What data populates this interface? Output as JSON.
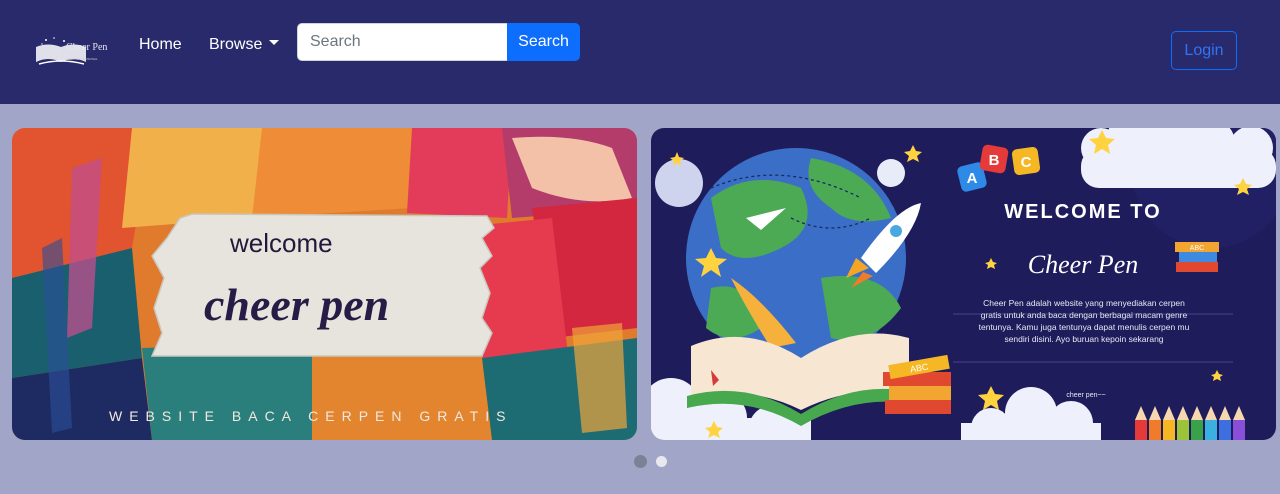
{
  "navbar": {
    "logo_text": "Cheer Pen",
    "logo_subtext": "CERPEN PERSONAL",
    "home_label": "Home",
    "browse_label": "Browse",
    "search_placeholder": "Search",
    "search_button": "Search",
    "login_button": "Login"
  },
  "carousel": {
    "slide1": {
      "line1": "welcome",
      "line2": "cheer pen",
      "tagline": "WEBSITE BACA CERPEN GRATIS"
    },
    "slide2": {
      "abc": [
        "A",
        "B",
        "C"
      ],
      "heading": "WELCOME TO",
      "brand": "Cheer Pen",
      "description_lines": [
        "Cheer Pen adalah website yang menyediakan cerpen",
        "gratis untuk anda baca dengan berbagai macam genre",
        "tentunya. Kamu juga tentunya dapat menulis cerpen mu",
        "sendiri disini. Ayo buruan kepoin sekarang"
      ],
      "footer": "cheer pen~~",
      "book_label": "ABC",
      "book_label_small": "ABC"
    },
    "active_index": 0,
    "count": 2
  },
  "colors": {
    "navbar_bg": "#282a6b",
    "page_bg": "#a1a6c8",
    "primary": "#0d6efd",
    "slide2_bg": "#1f1c5c"
  }
}
